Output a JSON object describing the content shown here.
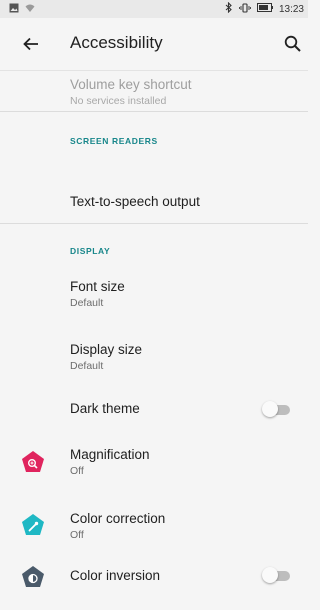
{
  "status_bar": {
    "time": "13:23"
  },
  "app_bar": {
    "title": "Accessibility"
  },
  "items": {
    "volume_key": {
      "title": "Volume key shortcut",
      "subtitle": "No services installed",
      "enabled": false
    },
    "tts": {
      "title": "Text-to-speech output"
    },
    "font_size": {
      "title": "Font size",
      "subtitle": "Default"
    },
    "display_size": {
      "title": "Display size",
      "subtitle": "Default"
    },
    "dark_theme": {
      "title": "Dark theme",
      "on": false
    },
    "magnification": {
      "title": "Magnification",
      "subtitle": "Off",
      "icon": "magnify-icon",
      "icon_color": "#e0245e"
    },
    "color_correction": {
      "title": "Color correction",
      "subtitle": "Off",
      "icon": "eyedropper-icon",
      "icon_color": "#1fb8c4"
    },
    "color_inversion": {
      "title": "Color inversion",
      "on": false,
      "icon": "inversion-icon",
      "icon_color": "#4a5a6a"
    }
  },
  "sections": {
    "screen_readers": "SCREEN READERS",
    "display": "DISPLAY"
  },
  "colors": {
    "accent": "#17868a",
    "background": "#f5f5f5"
  }
}
